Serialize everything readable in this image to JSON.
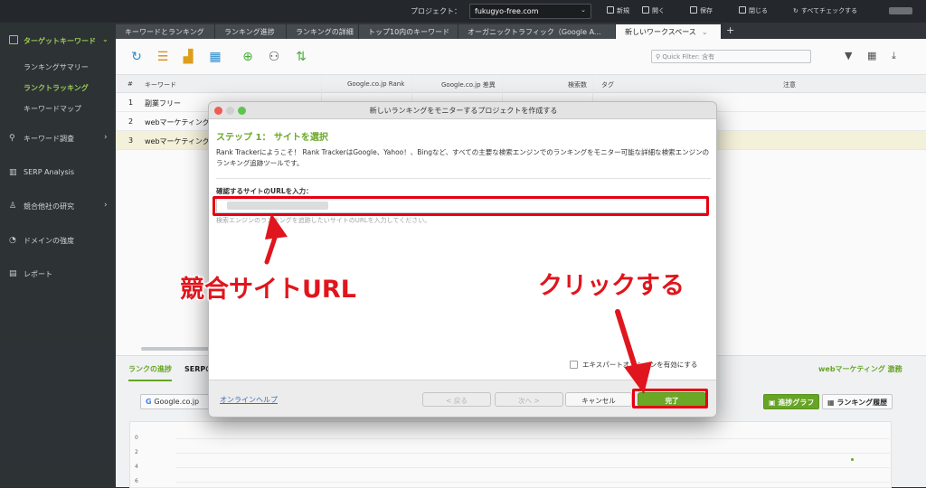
{
  "topbar": {
    "project_label": "プロジェクト：",
    "project_value": "fukugyo-free.com",
    "buttons": [
      "新規",
      "開く",
      "保存",
      "閉じる",
      "すべてチェックする"
    ]
  },
  "sidebar": {
    "section": "ターゲットキーワード",
    "sub_items": [
      "ランキングサマリー",
      "ランクトラッキング",
      "キーワードマップ"
    ],
    "items": [
      "キーワード調査",
      "SERP Analysis",
      "競合他社の研究",
      "ドメインの強度",
      "レポート"
    ]
  },
  "tabs": [
    "キーワードとランキング",
    "ランキング進捗",
    "ランキングの詳細",
    "トップ10内のキーワード",
    "オーガニックトラフィック（Google A...",
    "新しいワークスペース"
  ],
  "toolbar": {
    "quick_filter_placeholder": "Quick Filter: 含有"
  },
  "grid": {
    "headers": [
      "#",
      "キーワード",
      "Google.co.jp Rank",
      "Google.co.jp 差異",
      "検索数",
      "タグ",
      "注意"
    ],
    "rows": [
      {
        "num": "1",
        "keyword": "副業フリー"
      },
      {
        "num": "2",
        "keyword": "webマーケティング"
      },
      {
        "num": "3",
        "keyword": "webマーケティング"
      }
    ]
  },
  "bottom": {
    "tabs": [
      "ランクの進捗",
      "SERPの"
    ],
    "right_label": "webマーケティング 激務",
    "engine_select": "Google.co.jp",
    "btn_graph": "進捗グラフ",
    "btn_history": "ランキング履歴",
    "y_labels": [
      "0",
      "2",
      "4",
      "6"
    ]
  },
  "dialog": {
    "title": "新しいランキングをモニターするプロジェクトを作成する",
    "step": "ステップ 1： サイトを選択",
    "intro": "Rank Trackerにようこそ！ Rank TrackerはGoogle、Yahoo！、Bingなど、すべての主要な検索エンジンでのランキングをモニター可能な詳細な検索エンジンのランキング追跡ツールです。",
    "field_label": "確認するサイトのURLを入力：",
    "hint": "検索エンジンのランキングを追跡したいサイトのURLを入力してください。",
    "checkbox_label": "エキスパートオプションを有効にする",
    "help_link": "オンラインヘルプ",
    "back": "< 戻る",
    "next": "次へ >",
    "cancel": "キャンセル",
    "finish": "完了"
  },
  "annotations": {
    "left_text": "競合サイトURL",
    "right_text": "クリックする",
    "color": "#e0151d"
  }
}
